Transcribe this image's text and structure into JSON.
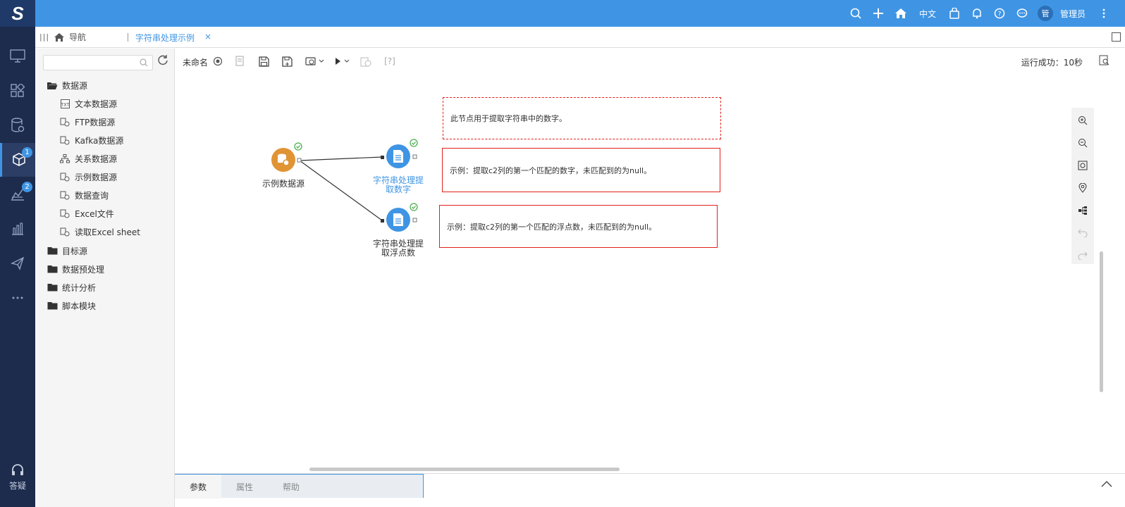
{
  "app": {
    "logo": "S"
  },
  "topbar": {
    "language": "中文",
    "avatar_char": "管",
    "username": "管理员"
  },
  "leftnav": {
    "badges": [
      "1",
      "2"
    ],
    "help_label": "答疑"
  },
  "tabs": {
    "home_label": "导航",
    "active_label": "字符串处理示例",
    "close_glyph": "×"
  },
  "sidebar": {
    "search_placeholder": "",
    "tree": [
      {
        "label": "数据源",
        "type": "folder-open"
      },
      {
        "label": "文本数据源",
        "type": "child"
      },
      {
        "label": "FTP数据源",
        "type": "child"
      },
      {
        "label": "Kafka数据源",
        "type": "child"
      },
      {
        "label": "关系数据源",
        "type": "child"
      },
      {
        "label": "示例数据源",
        "type": "child"
      },
      {
        "label": "数据查询",
        "type": "child"
      },
      {
        "label": "Excel文件",
        "type": "child"
      },
      {
        "label": "读取Excel sheet",
        "type": "child"
      },
      {
        "label": "目标源",
        "type": "folder"
      },
      {
        "label": "数据预处理",
        "type": "folder"
      },
      {
        "label": "统计分析",
        "type": "folder"
      },
      {
        "label": "脚本模块",
        "type": "folder"
      }
    ]
  },
  "toolbar": {
    "name": "未命名",
    "help_text": "[?]",
    "status": "运行成功：10秒"
  },
  "canvas": {
    "notes": [
      "此节点用于提取字符串中的数字。",
      "示例：提取c2列的第一个匹配的数字，未匹配到的为null。",
      "示例：提取c2列的第一个匹配的浮点数，未匹配到的为null。"
    ],
    "nodes": [
      {
        "label_line1": "示例数据源",
        "label_line2": "",
        "color": "#e09434"
      },
      {
        "label_line1": "字符串处理提",
        "label_line2": "取数字",
        "color": "#3f95e4"
      },
      {
        "label_line1": "字符串处理提",
        "label_line2": "取浮点数",
        "color": "#3f95e4"
      }
    ]
  },
  "bottom_tabs": [
    "参数",
    "属性",
    "帮助"
  ],
  "colors": {
    "primary": "#3f95e4",
    "nav_bg": "#1d2b4d",
    "success": "#4caf50",
    "note_border": "#e0201a"
  }
}
